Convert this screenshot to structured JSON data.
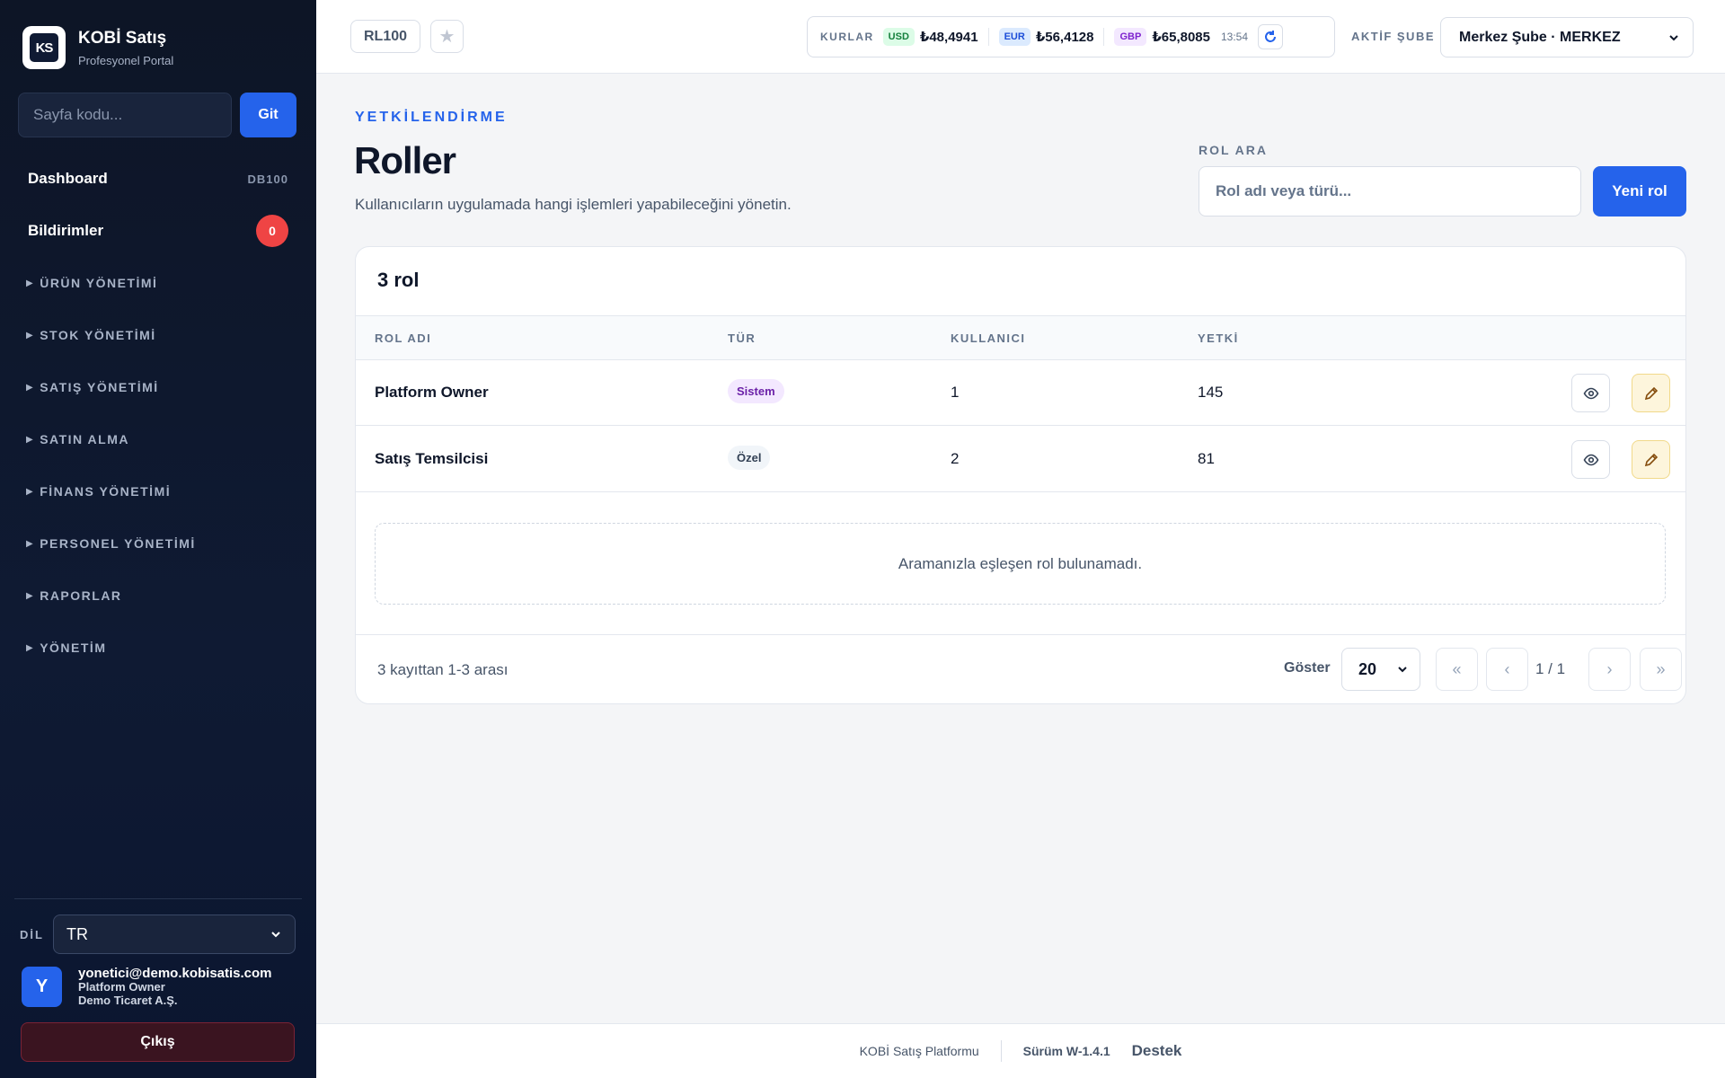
{
  "brand": {
    "name": "KOBİ Satış",
    "subtitle": "Profesyonel Portal",
    "logo_text": "KS"
  },
  "goto": {
    "placeholder": "Sayfa kodu...",
    "button": "Git"
  },
  "sidebar": {
    "dashboard": {
      "label": "Dashboard",
      "code": "DB100"
    },
    "notifications": {
      "label": "Bildirimler",
      "count": "0"
    },
    "groups": [
      {
        "label": "ÜRÜN YÖNETİMİ"
      },
      {
        "label": "STOK YÖNETİMİ"
      },
      {
        "label": "SATIŞ YÖNETİMİ"
      },
      {
        "label": "SATIN ALMA"
      },
      {
        "label": "FİNANS YÖNETİMİ"
      },
      {
        "label": "PERSONEL YÖNETİMİ"
      },
      {
        "label": "RAPORLAR"
      },
      {
        "label": "YÖNETİM"
      }
    ],
    "lang_label": "DİL",
    "lang_value": "TR",
    "user": {
      "initial": "Y",
      "email": "yonetici@demo.kobisatis.com",
      "role": "Platform Owner",
      "company": "Demo Ticaret A.Ş."
    },
    "logout": "Çıkış"
  },
  "topbar": {
    "page_code": "RL100",
    "rates_label": "KURLAR",
    "rates": [
      {
        "code": "USD",
        "value": "₺48,4941",
        "bg": "#dcfce7",
        "fg": "#15803d"
      },
      {
        "code": "EUR",
        "value": "₺56,4128",
        "bg": "#dbeafe",
        "fg": "#1d4ed8"
      },
      {
        "code": "GBP",
        "value": "₺65,8085",
        "bg": "#f3e8ff",
        "fg": "#7e22ce"
      }
    ],
    "rates_time": "13:54",
    "branch_label": "AKTİF ŞUBE",
    "branch_value": "Merkez Şube · MERKEZ"
  },
  "page": {
    "eyebrow": "YETKİLENDİRME",
    "title": "Roller",
    "subtitle": "Kullanıcıların uygulamada hangi işlemleri yapabileceğini yönetin.",
    "search_label": "ROL ARA",
    "search_placeholder": "Rol adı veya türü...",
    "new_button": "Yeni rol"
  },
  "table": {
    "count_title": "3 rol",
    "columns": [
      "ROL ADI",
      "TÜR",
      "KULLANICI",
      "YETKİ"
    ],
    "rows": [
      {
        "name": "Platform Owner",
        "type": "Sistem",
        "type_bg": "#f3e8ff",
        "type_fg": "#6b21a8",
        "users": "1",
        "perms": "145"
      },
      {
        "name": "Satış Temsilcisi",
        "type": "Özel",
        "type_bg": "#f1f5f9",
        "type_fg": "#334155",
        "users": "2",
        "perms": "81"
      }
    ],
    "empty_message": "Aramanızla eşleşen rol bulunamadı.",
    "range": "3 kayıttan 1-3 arası",
    "show_label": "Göster",
    "page_size": "20",
    "page_info": "1 / 1"
  },
  "footer": {
    "platform": "KOBİ Satış Platformu",
    "version": "Sürüm W-1.4.1",
    "support": "Destek"
  },
  "colors": {
    "accent": "#2563eb",
    "danger": "#ef4444",
    "sidebar_bg": "#0f1a33"
  }
}
